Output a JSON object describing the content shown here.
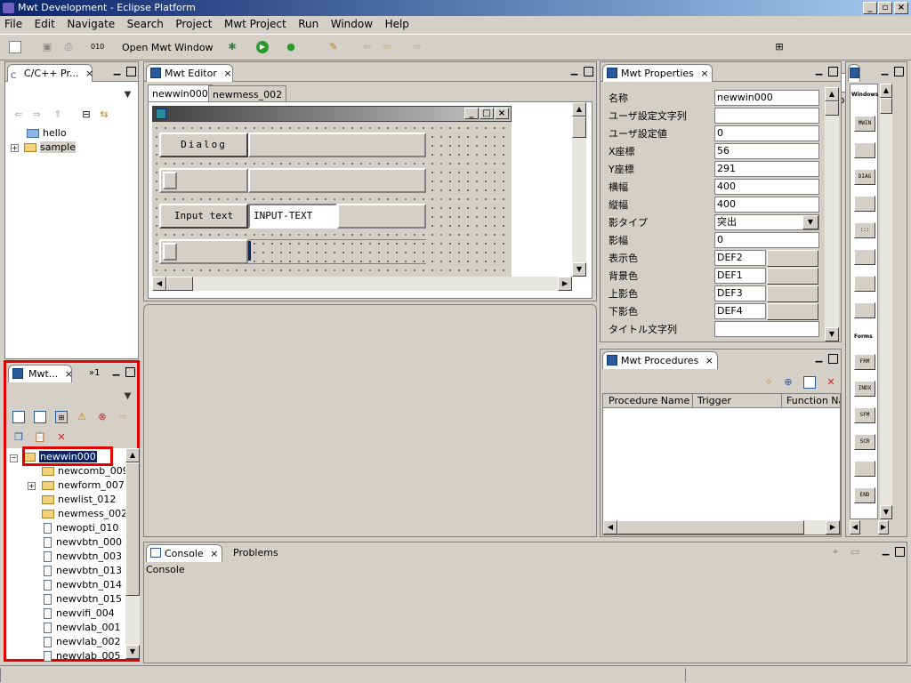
{
  "window": {
    "title": "Mwt Development - Eclipse Platform"
  },
  "menu": [
    "File",
    "Edit",
    "Navigate",
    "Search",
    "Project",
    "Mwt Project",
    "Run",
    "Window",
    "Help"
  ],
  "toolbar": {
    "open_mwt_window": "Open Mwt Window",
    "perspective": "Mwt Development"
  },
  "project_explorer": {
    "tab": "C/C++ Pr...",
    "items": [
      "hello",
      "sample"
    ]
  },
  "mwt_tree": {
    "tab": "Mwt...",
    "overflow": "»1",
    "selected": "newwin000",
    "items": [
      "newcomb_009",
      "newform_007",
      "newlist_012",
      "newmess_002",
      "newopti_010",
      "newvbtn_000",
      "newvbtn_003",
      "newvbtn_013",
      "newvbtn_014",
      "newvbtn_015",
      "newvifi_004",
      "newvlab_001",
      "newvlab_002",
      "newvlab_005"
    ]
  },
  "editor": {
    "tab": "Mwt Editor",
    "subtabs": [
      "newwin000",
      "newmess_002"
    ],
    "dialog_label": "Dialog",
    "input_label": "Input text",
    "input_value": "INPUT-TEXT"
  },
  "properties": {
    "tab": "Mwt Properties",
    "rows": [
      {
        "label": "名称",
        "value": "newwin000"
      },
      {
        "label": "ユーザ設定文字列",
        "value": ""
      },
      {
        "label": "ユーザ設定値",
        "value": "0"
      },
      {
        "label": "X座標",
        "value": "56"
      },
      {
        "label": "Y座標",
        "value": "291"
      },
      {
        "label": "横幅",
        "value": "400"
      },
      {
        "label": "縦幅",
        "value": "400"
      },
      {
        "label": "影タイプ",
        "value": "突出"
      },
      {
        "label": "影幅",
        "value": "0"
      },
      {
        "label": "表示色",
        "value": "DEF2"
      },
      {
        "label": "背景色",
        "value": "DEF1"
      },
      {
        "label": "上影色",
        "value": "DEF3"
      },
      {
        "label": "下影色",
        "value": "DEF4"
      },
      {
        "label": "タイトル文字列",
        "value": ""
      }
    ]
  },
  "procedures": {
    "tab": "Mwt Procedures",
    "columns": [
      "Procedure Name",
      "Trigger",
      "Function Na"
    ]
  },
  "palette": {
    "header": "Windows",
    "forms_header": "Forms",
    "items": [
      "MWIN",
      "",
      "DIAG",
      "",
      ":::",
      "",
      "",
      "",
      "FRM",
      "INDX",
      "SFM",
      "SCR",
      "",
      "END"
    ]
  },
  "console": {
    "tab": "Console",
    "tab2": "Problems",
    "label": "Console"
  }
}
